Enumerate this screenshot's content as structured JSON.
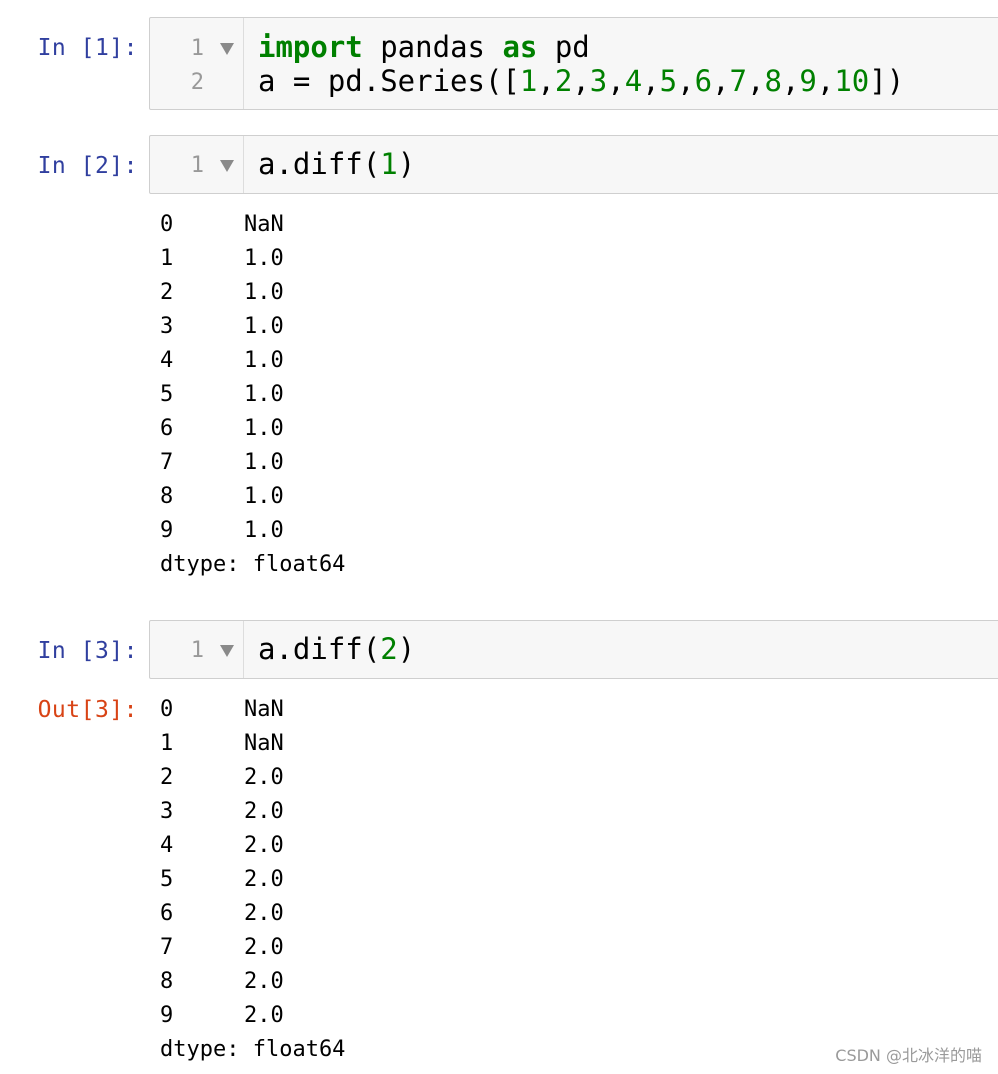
{
  "cells": [
    {
      "prompt": "In [1]:",
      "line_numbers": [
        "1",
        "2"
      ],
      "code": [
        [
          {
            "text": "import",
            "style": "kw"
          },
          {
            "text": " pandas ",
            "style": ""
          },
          {
            "text": "as",
            "style": "kw"
          },
          {
            "text": " pd",
            "style": ""
          }
        ],
        [
          {
            "text": "a = pd.Series([",
            "style": ""
          },
          {
            "text": "1",
            "style": "num"
          },
          {
            "text": ",",
            "style": ""
          },
          {
            "text": "2",
            "style": "num"
          },
          {
            "text": ",",
            "style": ""
          },
          {
            "text": "3",
            "style": "num"
          },
          {
            "text": ",",
            "style": ""
          },
          {
            "text": "4",
            "style": "num"
          },
          {
            "text": ",",
            "style": ""
          },
          {
            "text": "5",
            "style": "num"
          },
          {
            "text": ",",
            "style": ""
          },
          {
            "text": "6",
            "style": "num"
          },
          {
            "text": ",",
            "style": ""
          },
          {
            "text": "7",
            "style": "num"
          },
          {
            "text": ",",
            "style": ""
          },
          {
            "text": "8",
            "style": "num"
          },
          {
            "text": ",",
            "style": ""
          },
          {
            "text": "9",
            "style": "num"
          },
          {
            "text": ",",
            "style": ""
          },
          {
            "text": "10",
            "style": "num"
          },
          {
            "text": "])",
            "style": ""
          }
        ]
      ]
    },
    {
      "prompt": "In [2]:",
      "line_numbers": [
        "1"
      ],
      "code": [
        [
          {
            "text": "a.diff(",
            "style": ""
          },
          {
            "text": "1",
            "style": "num"
          },
          {
            "text": ")",
            "style": ""
          }
        ]
      ],
      "output": {
        "prompt": "",
        "rows": [
          {
            "index": "0",
            "value": "NaN"
          },
          {
            "index": "1",
            "value": "1.0"
          },
          {
            "index": "2",
            "value": "1.0"
          },
          {
            "index": "3",
            "value": "1.0"
          },
          {
            "index": "4",
            "value": "1.0"
          },
          {
            "index": "5",
            "value": "1.0"
          },
          {
            "index": "6",
            "value": "1.0"
          },
          {
            "index": "7",
            "value": "1.0"
          },
          {
            "index": "8",
            "value": "1.0"
          },
          {
            "index": "9",
            "value": "1.0"
          }
        ],
        "dtype": "dtype: float64"
      }
    },
    {
      "prompt": "In [3]:",
      "line_numbers": [
        "1"
      ],
      "code": [
        [
          {
            "text": "a.diff(",
            "style": ""
          },
          {
            "text": "2",
            "style": "num"
          },
          {
            "text": ")",
            "style": ""
          }
        ]
      ],
      "output": {
        "prompt": "Out[3]:",
        "rows": [
          {
            "index": "0",
            "value": "NaN"
          },
          {
            "index": "1",
            "value": "NaN"
          },
          {
            "index": "2",
            "value": "2.0"
          },
          {
            "index": "3",
            "value": "2.0"
          },
          {
            "index": "4",
            "value": "2.0"
          },
          {
            "index": "5",
            "value": "2.0"
          },
          {
            "index": "6",
            "value": "2.0"
          },
          {
            "index": "7",
            "value": "2.0"
          },
          {
            "index": "8",
            "value": "2.0"
          },
          {
            "index": "9",
            "value": "2.0"
          }
        ],
        "dtype": "dtype: float64"
      }
    }
  ],
  "watermark": "CSDN @北冰洋的喵",
  "colors": {
    "in_prompt": "#303f9f",
    "out_prompt": "#d84315",
    "keyword": "#008000",
    "number": "#008000",
    "cell_background": "#f7f7f7"
  },
  "icons": [
    "fold-arrow-icon"
  ]
}
